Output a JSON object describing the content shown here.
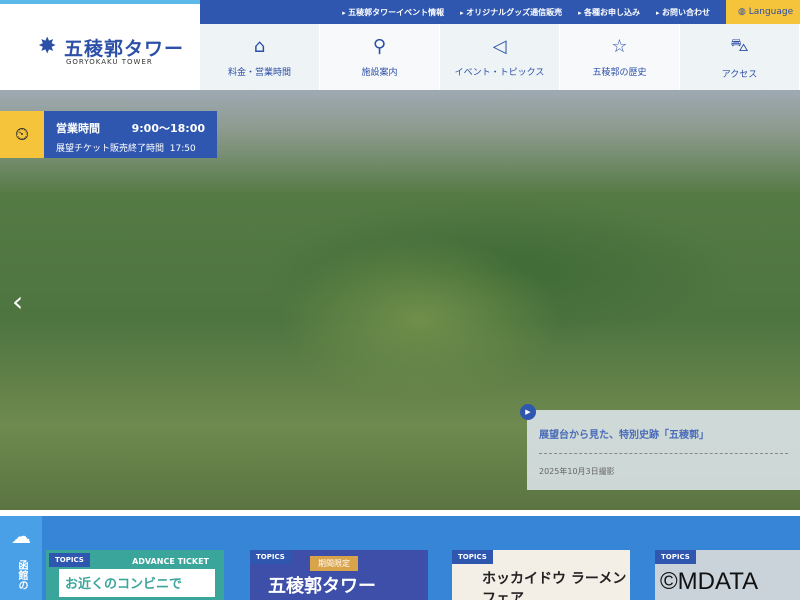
{
  "header": {
    "logo_jp": "五稜郭タワー",
    "logo_en": "GORYOKAKU TOWER",
    "top_links": [
      "五稜郭タワーイベント情報",
      "オリジナルグッズ通信販売",
      "各種お申し込み",
      "お問い合わせ"
    ],
    "language": "Language",
    "nav": [
      {
        "label": "料金・営業時間",
        "icon": "clock-ticket-icon"
      },
      {
        "label": "施設案内",
        "icon": "map-pin-icon"
      },
      {
        "label": "イベント・トピックス",
        "icon": "megaphone-icon"
      },
      {
        "label": "五稜郭の歴史",
        "icon": "star-icon"
      },
      {
        "label": "アクセス",
        "icon": "car-icon"
      }
    ]
  },
  "hours": {
    "label": "営業時間",
    "time": "9:00〜18:00",
    "ticket_label": "展望チケット販売終了時間",
    "ticket_time": "17:50"
  },
  "caption": {
    "title": "展望台から見た、特別史跡「五稜郭」",
    "date": "2025年10月3日撮影"
  },
  "weather": {
    "label": "函館の"
  },
  "topics": {
    "tag": "TOPICS",
    "card1_header": "ADVANCE TICKET",
    "card1_text": "お近くのコンビニで",
    "card2_ribbon": "期間限定",
    "card2_text": "五稜郭タワー",
    "card3_text": "ホッカイドウ ラーメンフェア"
  },
  "watermark": "©MDATA"
}
